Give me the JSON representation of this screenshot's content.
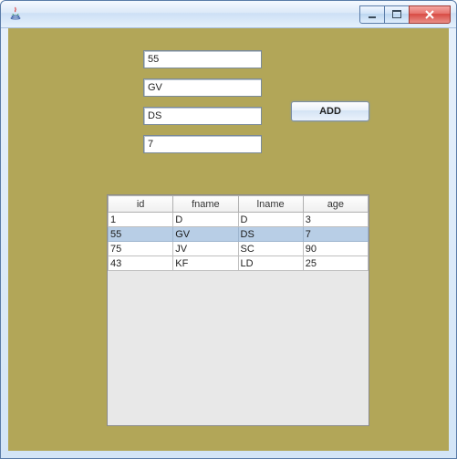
{
  "window": {
    "title": ""
  },
  "form": {
    "id_value": "55",
    "fname_value": "GV",
    "lname_value": "DS",
    "age_value": "7",
    "add_label": "ADD"
  },
  "table": {
    "headers": {
      "id": "id",
      "fname": "fname",
      "lname": "lname",
      "age": "age"
    },
    "rows": [
      {
        "id": "1",
        "fname": "D",
        "lname": "D",
        "age": "3",
        "selected": false
      },
      {
        "id": "55",
        "fname": "GV",
        "lname": "DS",
        "age": "7",
        "selected": true
      },
      {
        "id": "75",
        "fname": "JV",
        "lname": "SC",
        "age": "90",
        "selected": false
      },
      {
        "id": "43",
        "fname": "KF",
        "lname": "LD",
        "age": "25",
        "selected": false
      }
    ]
  }
}
